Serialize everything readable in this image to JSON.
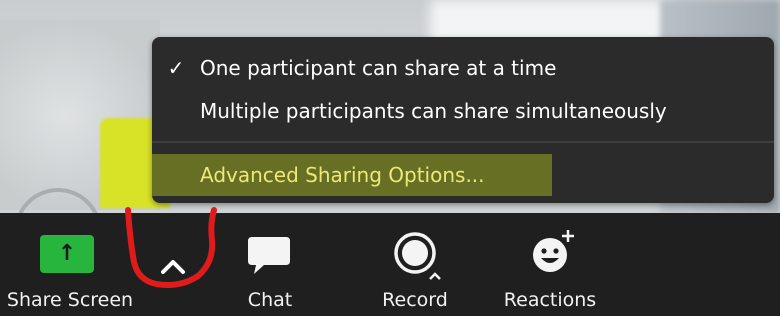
{
  "menu": {
    "items": [
      {
        "label": "One participant can share at a time",
        "checked": true,
        "check_glyph": "✓"
      },
      {
        "label": "Multiple participants can share simultaneously",
        "checked": false
      },
      {
        "label": "Advanced Sharing Options...",
        "highlighted": true
      }
    ]
  },
  "toolbar": {
    "share_screen": {
      "label": "Share Screen",
      "icon": "up-arrow-icon",
      "icon_glyph": "↑"
    },
    "share_options": {
      "icon": "chevron-up-icon",
      "glyph": "^"
    },
    "chat": {
      "label": "Chat",
      "icon": "chat-bubble-icon"
    },
    "record": {
      "label": "Record",
      "icon": "record-icon"
    },
    "reactions": {
      "label": "Reactions",
      "icon": "smiley-plus-icon"
    }
  },
  "colors": {
    "menu_bg": "#2b2b2c",
    "toolbar_bg": "#1f1f1f",
    "share_green": "#27b53e",
    "highlight": "#b2c41a",
    "annotation_red": "#e01b1b"
  }
}
